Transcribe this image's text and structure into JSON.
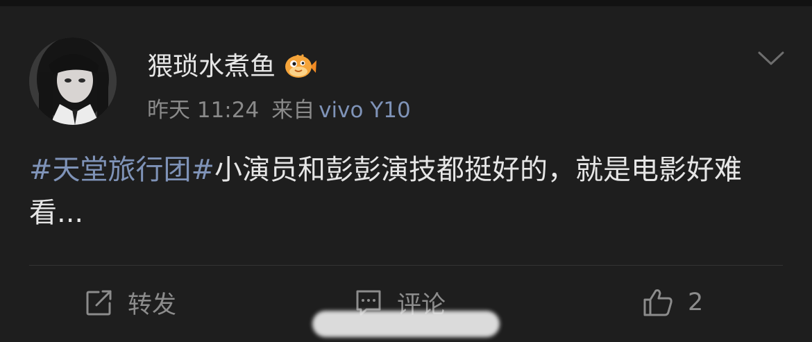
{
  "post": {
    "author": {
      "name": "猥琐水煮鱼",
      "badge_icon": "fish-badge-icon",
      "avatar_icon": "avatar-photo"
    },
    "meta": {
      "time": "昨天 11:24",
      "source_prefix": "来自",
      "source_device": "vivo Y10"
    },
    "content": {
      "hashtag": "#天堂旅行团#",
      "text": "小演员和彭彭演技都挺好的，就是电影好难看..."
    },
    "more_icon": "chevron-down-icon"
  },
  "actions": {
    "repost": {
      "label": "转发",
      "icon": "share-icon"
    },
    "comment": {
      "label": "评论",
      "icon": "comment-icon"
    },
    "like": {
      "count": "2",
      "icon": "thumbs-up-icon"
    }
  },
  "colors": {
    "background": "#1e1e1e",
    "primary_text": "#e6e6e6",
    "secondary_text": "#8a8a8a",
    "link_blue": "#7f93b8",
    "action_gray": "#8c8c8c",
    "badge_orange": "#f5a43a"
  }
}
